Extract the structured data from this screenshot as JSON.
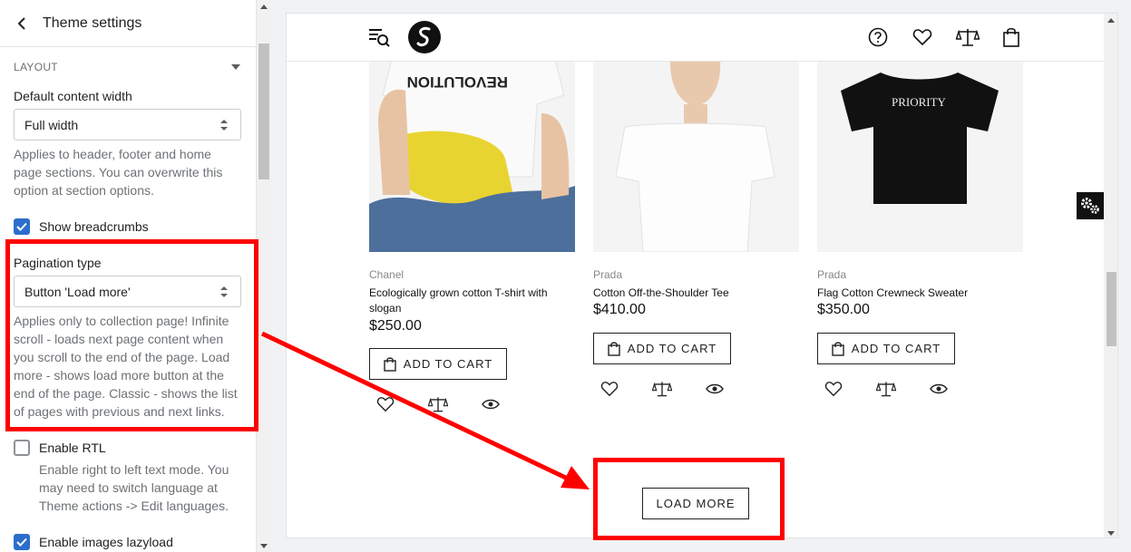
{
  "panel": {
    "title": "Theme settings",
    "section_title": "LAYOUT",
    "content_width": {
      "label": "Default content width",
      "value": "Full width",
      "help": "Applies to header, footer and home page sections. You can overwrite this option at section options."
    },
    "breadcrumbs": {
      "label": "Show breadcrumbs",
      "checked": true
    },
    "pagination": {
      "label": "Pagination type",
      "value": "Button 'Load more'",
      "help": "Applies only to collection page! Infinite scroll - loads next page content when you scroll to the end of the page. Load more - shows load more button at the end of the page. Classic - shows the list of pages with previous and next links."
    },
    "rtl": {
      "label": "Enable RTL",
      "checked": false,
      "help": "Enable right to left text mode. You may need to switch language at Theme actions -> Edit languages."
    },
    "lazyload": {
      "label": "Enable images lazyload",
      "checked": true
    }
  },
  "preview": {
    "products": [
      {
        "brand": "Chanel",
        "name": "Ecologically grown cotton T-shirt with slogan",
        "price": "$250.00",
        "cart_label": "ADD TO CART",
        "image_text": "REVOLUTION"
      },
      {
        "brand": "Prada",
        "name": "Cotton Off-the-Shoulder Tee",
        "price": "$410.00",
        "cart_label": "ADD TO CART"
      },
      {
        "brand": "Prada",
        "name": "Flag Cotton Crewneck Sweater",
        "price": "$350.00",
        "cart_label": "ADD TO CART",
        "image_text": "PRIORITY"
      }
    ],
    "load_more_label": "LOAD MORE"
  },
  "colors": {
    "highlight": "#ff0000",
    "checkbox": "#2c6ecb"
  }
}
